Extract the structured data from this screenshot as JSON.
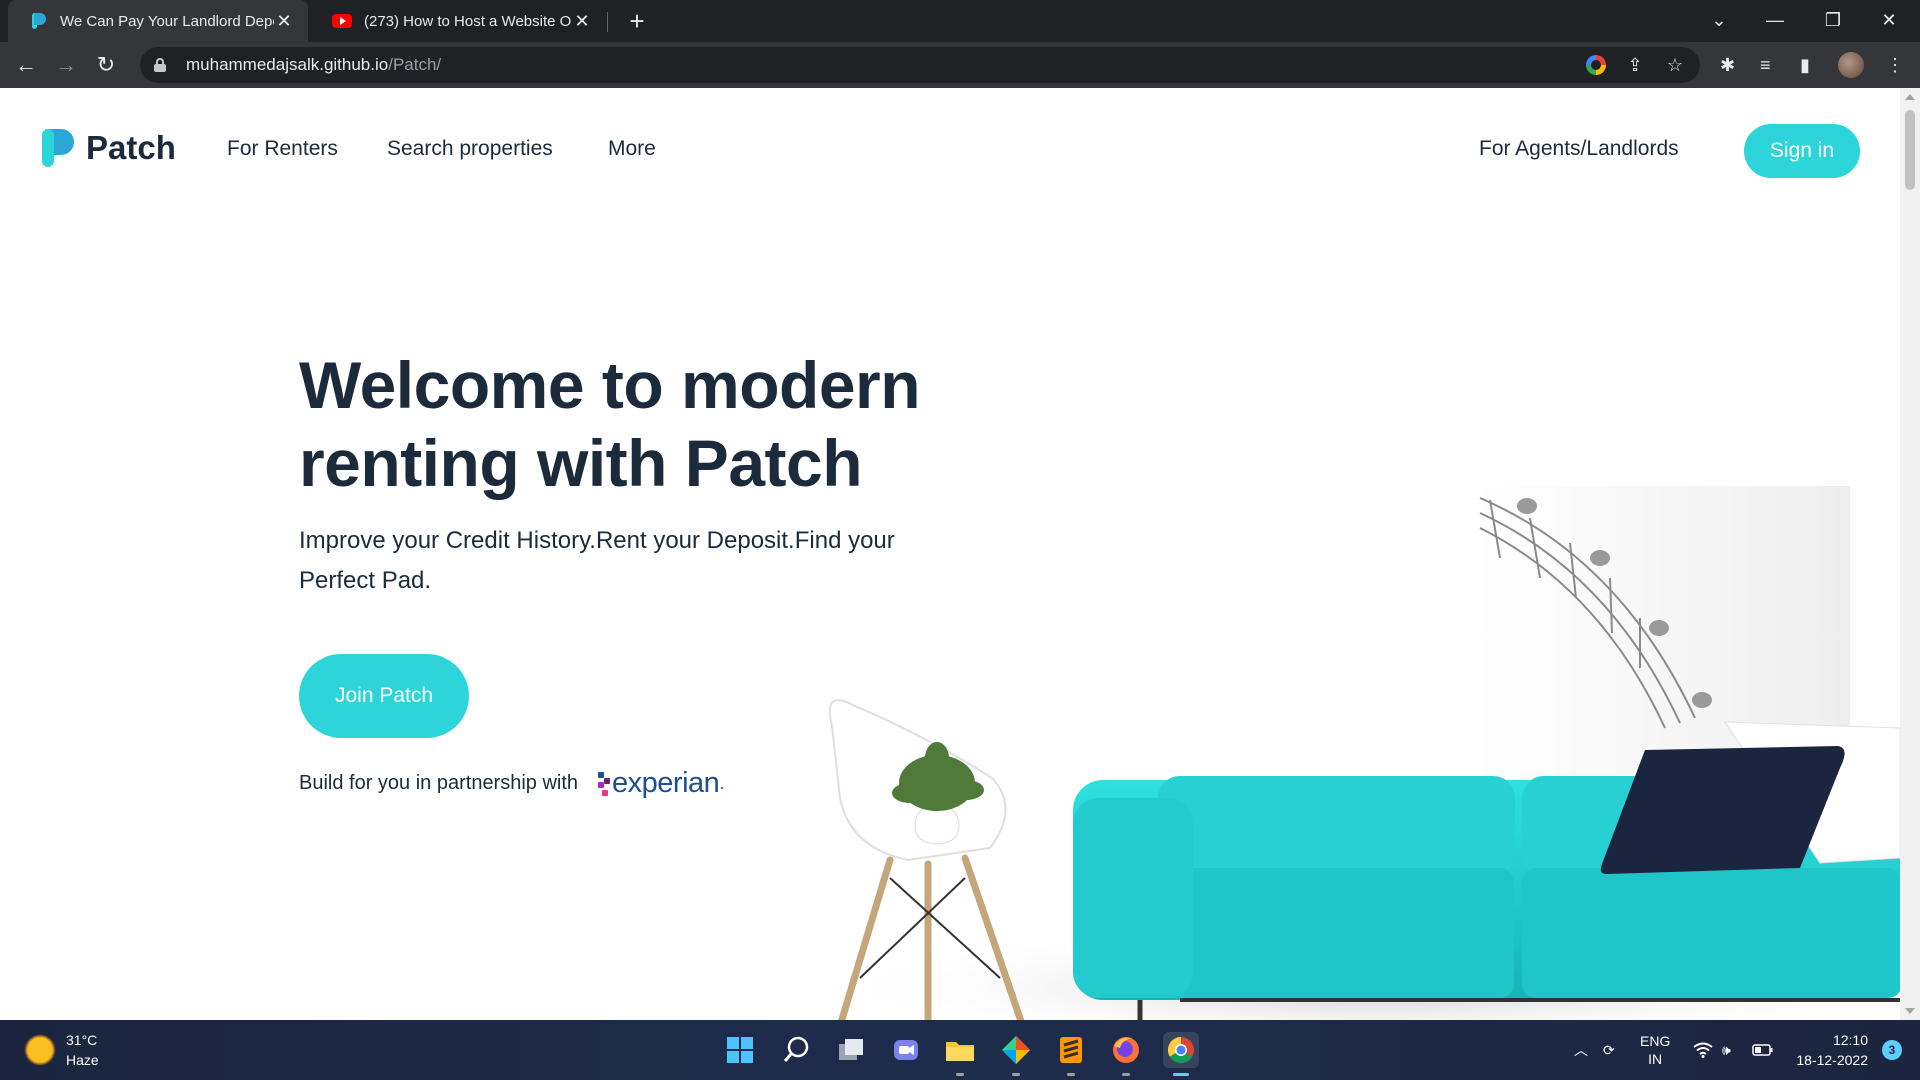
{
  "browser": {
    "tabs": [
      {
        "title": "We Can Pay Your Landlord Depo",
        "active": true,
        "favicon": "patch-favicon-icon"
      },
      {
        "title": "(273) How to Host a Website On",
        "active": false,
        "favicon": "youtube-favicon-icon"
      }
    ],
    "url": {
      "host": "muhammedajsalk.github.io",
      "path": "/Patch/"
    }
  },
  "site": {
    "brand": "Patch",
    "nav": [
      "For Renters",
      "Search properties",
      "More"
    ],
    "agents_link": "For Agents/Landlords",
    "signin_label": "Sign in",
    "hero": {
      "title": "Welcome to modern renting with Patch",
      "subtitle": "Improve your Credit History.Rent your Deposit.Find your Perfect Pad.",
      "cta": "Join Patch",
      "partner_text": "Build for you in partnership with",
      "partner_name": "experian",
      "partner_suffix": "."
    },
    "colors": {
      "accent": "#2dd4d9",
      "text": "#1b2b3c"
    }
  },
  "taskbar": {
    "weather": {
      "temp": "31°C",
      "condition": "Haze"
    },
    "language": {
      "lang": "ENG",
      "region": "IN"
    },
    "time": "12:10",
    "date": "18-12-2022",
    "notifications": "3"
  }
}
